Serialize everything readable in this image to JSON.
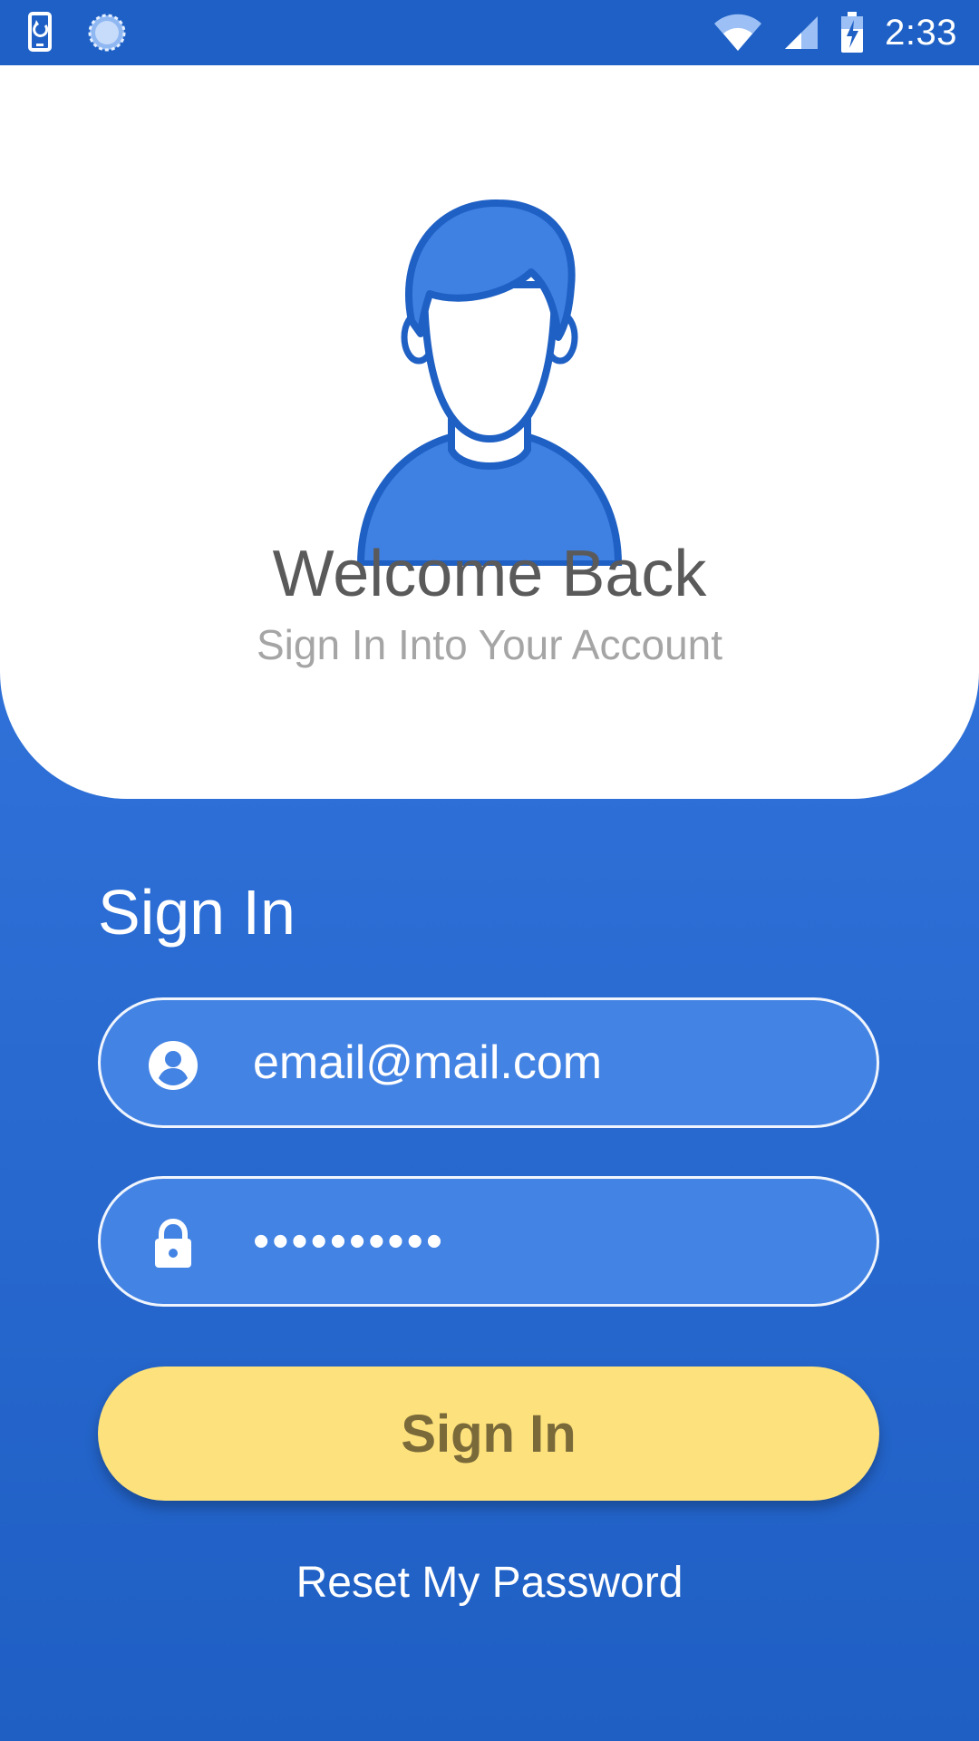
{
  "status_bar": {
    "time": "2:33",
    "icons": [
      "phone-rotate-icon",
      "loading-spinner-icon",
      "wifi-icon",
      "cell-signal-icon",
      "battery-charging-icon"
    ]
  },
  "header": {
    "title": "Welcome Back",
    "subtitle": "Sign In Into Your Account",
    "avatar_icon": "user-avatar-icon"
  },
  "form": {
    "heading": "Sign In",
    "email": {
      "value": "email@mail.com",
      "icon": "account-circle-icon"
    },
    "password": {
      "value": "••••••••••",
      "icon": "lock-icon"
    },
    "submit_label": "Sign In",
    "reset_label": "Reset My Password"
  },
  "colors": {
    "primary_blue": "#2d6fd6",
    "status_bar": "#1e60c5",
    "field_fill": "#4383e4",
    "button_yellow": "#fde17c",
    "button_text": "#7a6a3a",
    "title_text": "#5a5a5a",
    "subtitle_text": "#a5a5a5"
  }
}
